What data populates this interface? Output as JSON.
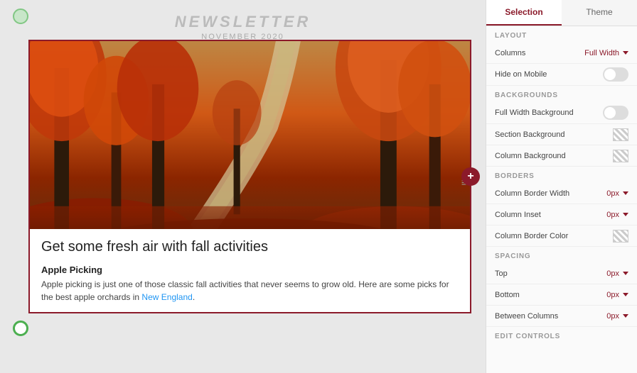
{
  "tabs": {
    "selection": "Selection",
    "theme": "Theme"
  },
  "sections": {
    "layout": "Layout",
    "backgrounds": "Backgrounds",
    "borders": "Borders",
    "spacing": "Spacing",
    "edit_controls": "Edit Controls"
  },
  "layout": {
    "columns_label": "Columns",
    "columns_value": "Full Width",
    "hide_mobile_label": "Hide on Mobile"
  },
  "backgrounds": {
    "full_width_label": "Full Width Background",
    "section_label": "Section Background",
    "column_label": "Column Background"
  },
  "borders": {
    "border_width_label": "Column Border Width",
    "border_width_value": "0px",
    "inset_label": "Column Inset",
    "inset_value": "0px",
    "border_color_label": "Column Border Color"
  },
  "spacing": {
    "top_label": "Top",
    "top_value": "0px",
    "bottom_label": "Bottom",
    "bottom_value": "0px",
    "between_label": "Between Columns",
    "between_value": "0px"
  },
  "newsletter": {
    "title": "NEWSLETTER",
    "date": "NOVEMBER 2020"
  },
  "article": {
    "heading": "Get some fresh air with fall activities",
    "subheading": "Apple Picking",
    "body_start": "Apple picking is just one of those classic fall activities that never seems to grow old. Here are some picks for the best apple orchards in ",
    "body_link": "New England",
    "body_end": "."
  },
  "icons": {
    "copy": "⧉",
    "delete": "🗑",
    "drag": "≡",
    "add": "+",
    "chevron_down": "▾"
  },
  "colors": {
    "accent": "#8b1a2a",
    "toggle_off": "#ddd",
    "toggle_on": "#4caf50"
  }
}
